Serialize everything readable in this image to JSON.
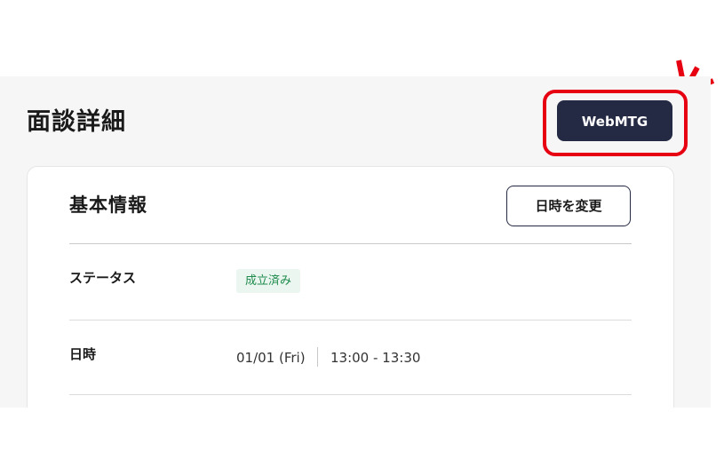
{
  "header": {
    "title": "面談詳細",
    "webmtg_label": "WebMTG"
  },
  "card": {
    "title": "基本情報",
    "change_datetime_label": "日時を変更",
    "rows": [
      {
        "label": "ステータス",
        "badge": "成立済み"
      },
      {
        "label": "日時",
        "date": "01/01 (Fri)",
        "time": "13:00 - 13:30"
      }
    ]
  },
  "colors": {
    "primary_button": "#252a44",
    "highlight": "#e60012",
    "status_text": "#1e8a4c",
    "status_background": "#eaf6ef",
    "panel_background": "#f6f6f6"
  },
  "icons": {
    "emphasis": "emphasis-lines-icon"
  }
}
